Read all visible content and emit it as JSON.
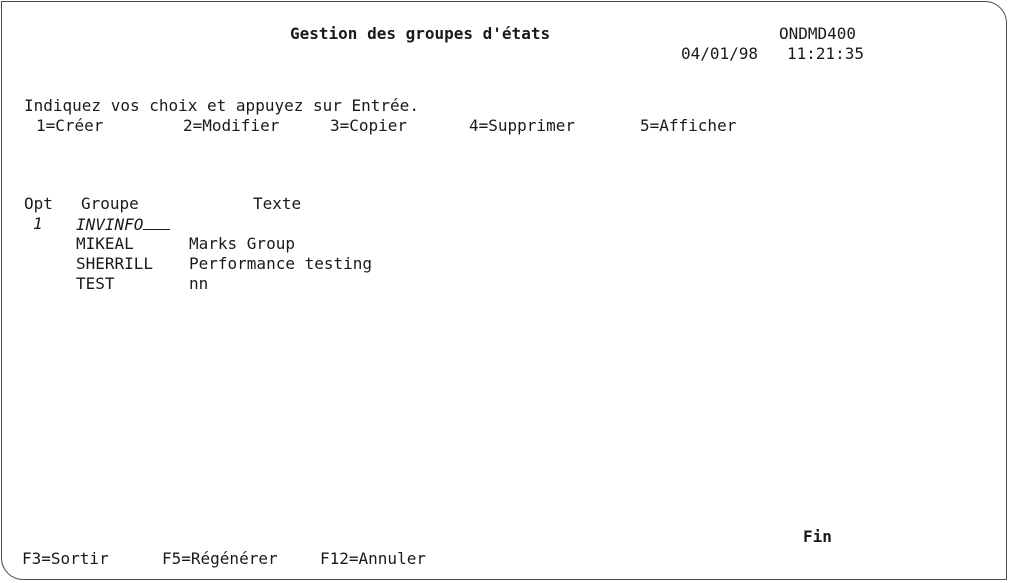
{
  "header": {
    "title": "Gestion des groupes d'états",
    "screen_id": "ONDMD400",
    "date": "04/01/98",
    "time": "11:21:35"
  },
  "instructions": {
    "prompt": "Indiquez vos choix et appuyez sur Entrée.",
    "options": [
      {
        "label": "1=Créer"
      },
      {
        "label": "2=Modifier"
      },
      {
        "label": "3=Copier"
      },
      {
        "label": "4=Supprimer"
      },
      {
        "label": "5=Afficher"
      }
    ]
  },
  "table": {
    "headers": {
      "opt": "Opt",
      "groupe": "Groupe",
      "texte": "Texte"
    },
    "input_row": {
      "opt_value": "1",
      "groupe_value": "INVINFO"
    },
    "rows": [
      {
        "groupe": "MIKEAL",
        "texte": "Marks Group"
      },
      {
        "groupe": "SHERRILL",
        "texte": "Performance testing"
      },
      {
        "groupe": "TEST",
        "texte": "nn"
      }
    ]
  },
  "status": {
    "end_marker": "Fin"
  },
  "function_keys": [
    {
      "label": "F3=Sortir"
    },
    {
      "label": "F5=Régénérer"
    },
    {
      "label": "F12=Annuler"
    }
  ]
}
